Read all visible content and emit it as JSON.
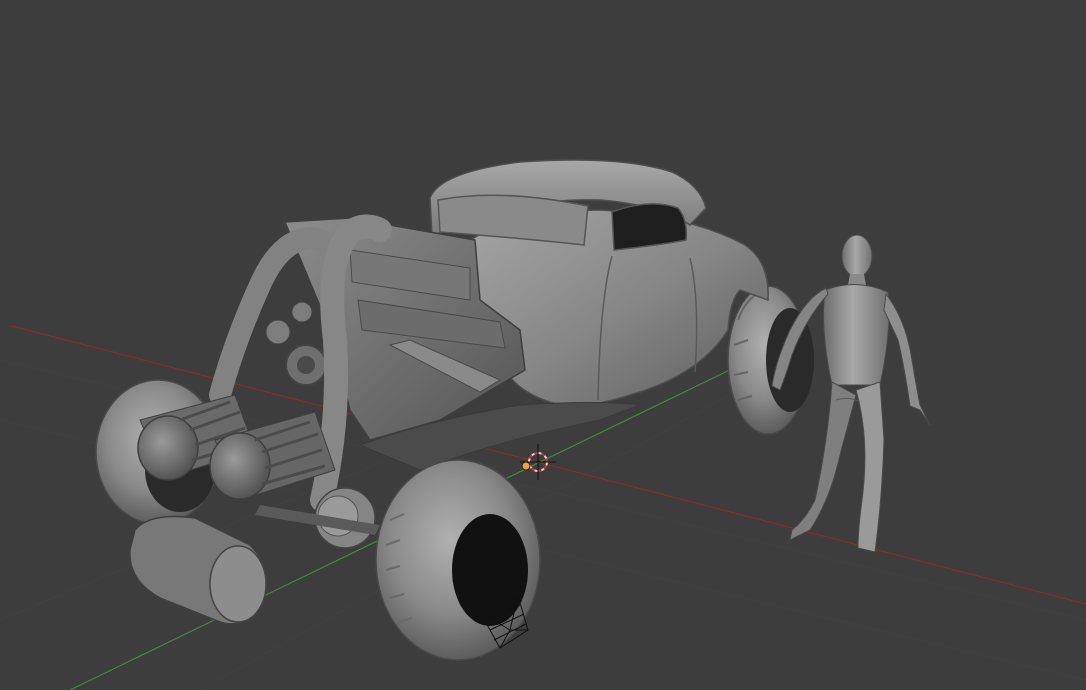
{
  "viewport": {
    "mode": "solid-shading",
    "background_color": "#3d3d3d",
    "axis_x_color": "#8c2b2b",
    "axis_y_color": "#3e8a3e",
    "grid": true
  },
  "objects": [
    {
      "name": "hot-rod-car",
      "type": "mesh"
    },
    {
      "name": "human-figure",
      "type": "mesh"
    },
    {
      "name": "camera-object",
      "type": "camera"
    },
    {
      "name": "object-origin",
      "type": "empty"
    }
  ],
  "cursor_3d": {
    "visible": true
  }
}
